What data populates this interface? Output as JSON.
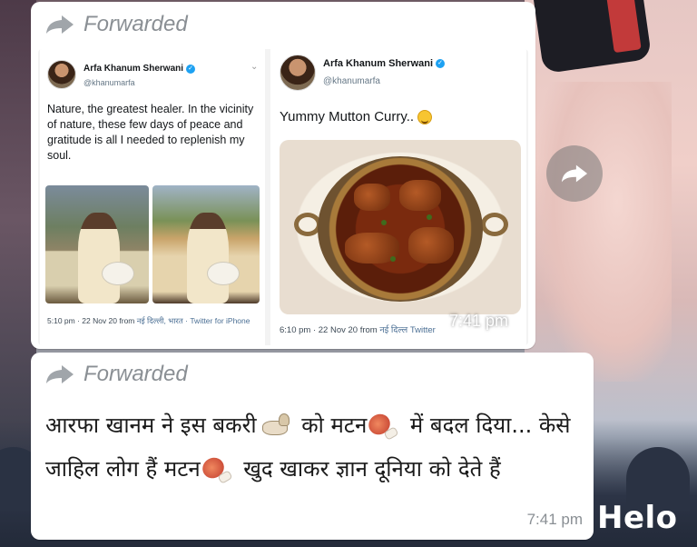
{
  "forward_label": "Forwarded",
  "message1": {
    "time": "7:41 pm",
    "tweet_left": {
      "name": "Arfa Khanum Sherwani",
      "handle": "@khanumarfa",
      "text": "Nature, the greatest healer. In the vicinity of nature, these few days of peace and gratitude is all I needed to replenish my soul.",
      "meta_time": "5:10 pm · 22 Nov 20 from",
      "meta_place": "नई दिल्ली, भारत",
      "meta_source": "· Twitter for iPhone"
    },
    "tweet_right": {
      "name": "Arfa Khanum Sherwani",
      "handle": "@khanumarfa",
      "text": "Yummy Mutton Curry..",
      "meta_time": "6:10 pm · 22 Nov 20 from",
      "meta_place": "नई दिल्ल",
      "meta_source": "Twitter"
    }
  },
  "message2": {
    "part1": "आरफा खानम ने इस बकरी",
    "part2": " को मटन",
    "part3": " में बदल दिया... केसे जाहिल लोग हैं मटन",
    "part4": " खुद खाकर ज्ञान दूनिया को देते  हैं",
    "time": "7:41 pm"
  },
  "watermark": "Helo",
  "icons": {
    "forward": "forward-arrow-icon",
    "share": "share-arrow-icon",
    "verified": "verified-badge-icon",
    "goat": "goat-emoji-icon",
    "meat": "meat-on-bone-emoji-icon",
    "smile": "smiling-face-emoji-icon"
  },
  "colors": {
    "bubble": "#ffffff",
    "forwarded_text": "#8a8f94",
    "link_blue": "#4b6f94",
    "verified_blue": "#1da1f2"
  }
}
